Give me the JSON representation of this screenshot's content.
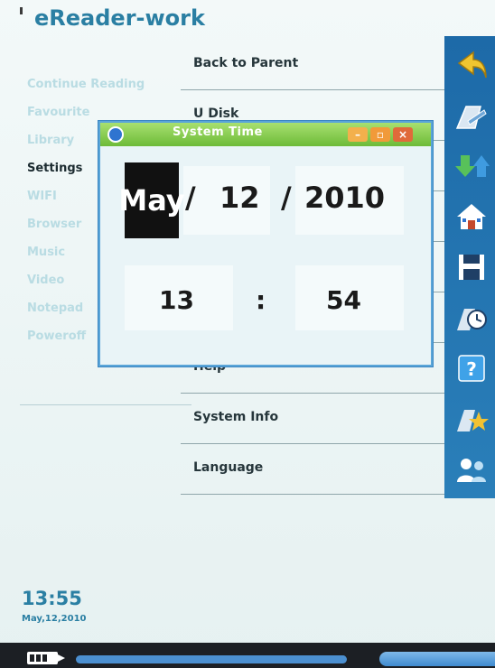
{
  "app": {
    "title": "eReader-work"
  },
  "left_menu": {
    "items": [
      {
        "label": "Continue Reading",
        "active": false
      },
      {
        "label": "Favourite",
        "active": false
      },
      {
        "label": "Library",
        "active": false
      },
      {
        "label": "Settings",
        "active": true
      },
      {
        "label": "WIFI",
        "active": false
      },
      {
        "label": "Browser",
        "active": false
      },
      {
        "label": "Music",
        "active": false
      },
      {
        "label": "Video",
        "active": false
      },
      {
        "label": "Notepad",
        "active": false
      },
      {
        "label": "Poweroff",
        "active": false
      }
    ]
  },
  "settings_list": {
    "items": [
      {
        "label": "Back to Parent"
      },
      {
        "label": "U Disk"
      },
      {
        "label": ""
      },
      {
        "label": ""
      },
      {
        "label": ""
      },
      {
        "label": ""
      },
      {
        "label": "Help"
      },
      {
        "label": "System Info"
      },
      {
        "label": "Language"
      }
    ]
  },
  "toolbar": {
    "icons": [
      "back-arrow-icon",
      "edit-icon",
      "swap-icon",
      "home-icon",
      "save-icon",
      "clock-icon",
      "help-icon",
      "favorite-icon",
      "users-icon"
    ]
  },
  "dialog": {
    "title": "System Time",
    "date": {
      "month": "May",
      "sep1": "/",
      "day": "12",
      "sep2": "/",
      "year": "2010"
    },
    "time": {
      "hour": "13",
      "sep": ":",
      "minute": "54"
    }
  },
  "clock": {
    "time": "13:55",
    "date": "May,12,2010"
  },
  "colors": {
    "accent": "#2a7fa3",
    "toolbar": "#1d6aa8",
    "titlebar": "#6dbb38"
  }
}
